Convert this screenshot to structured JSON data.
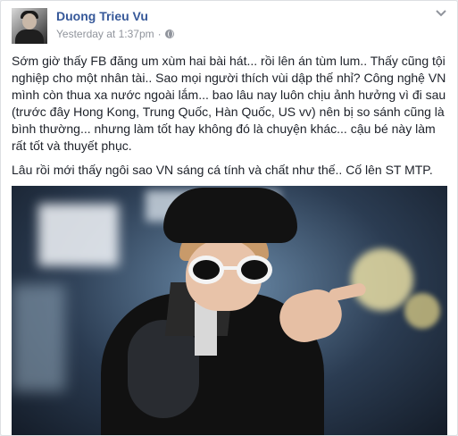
{
  "post": {
    "author_name": "Duong Trieu Vu",
    "timestamp": "Yesterday at 1:37pm",
    "separator": "·",
    "audience_icon": "globe-icon",
    "menu_icon": "chevron-down-icon",
    "paragraph_1": "Sớm giờ thấy FB đăng um xùm hai bài hát... rồi lên án tùm lum.. Thấy cũng tội nghiệp cho một nhân tài.. Sao mọi người thích vùi dập thế nhỉ? Công nghệ VN mình còn thua xa nước ngoài lắm... bao lâu nay luôn chịu ảnh hưởng vì đi sau (trước đây Hong Kong, Trung Quốc, Hàn Quốc, US vv) nên bị so sánh cũng là bình thường... nhưng làm tốt hay không đó là chuyện khác... cậu bé này làm rất tốt và thuyết phục.",
    "paragraph_2": "Lâu rồi mới thấy ngôi sao VN sáng cá tính và chất như thế.. Cố lên ST MTP."
  },
  "colors": {
    "link": "#365899",
    "meta": "#90949c",
    "text": "#1d2129",
    "background": "#e9ebee",
    "card": "#ffffff"
  }
}
